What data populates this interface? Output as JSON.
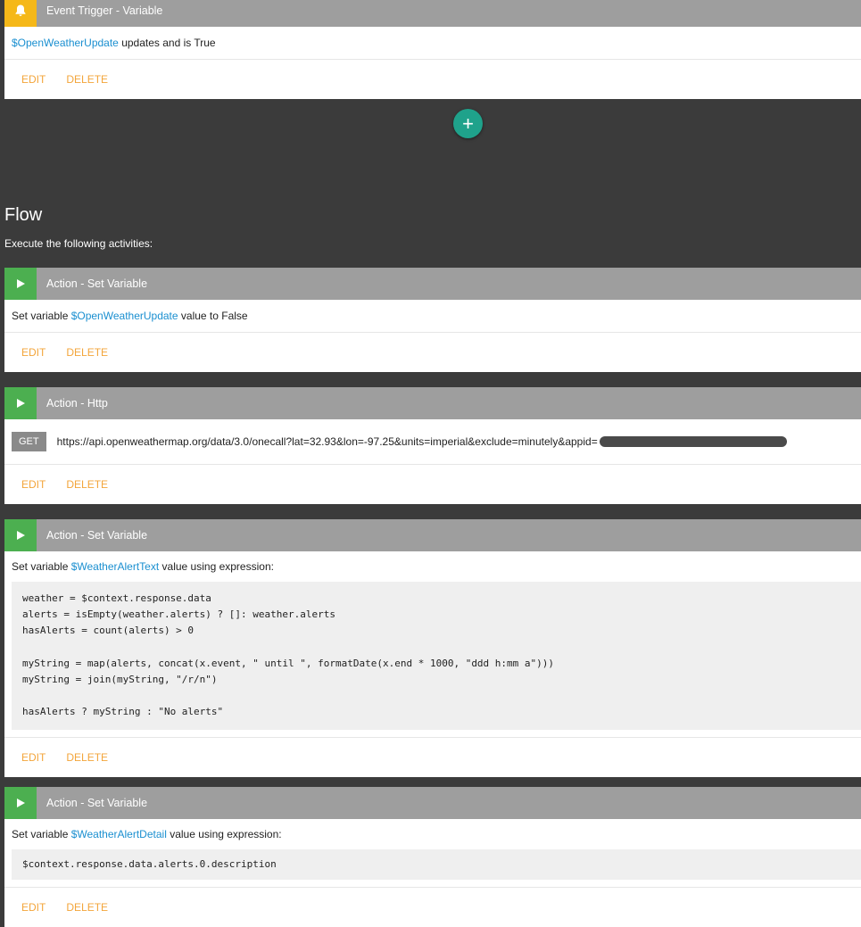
{
  "trigger": {
    "title": "Event Trigger - Variable",
    "var": "$OpenWeatherUpdate",
    "text": " updates and is True",
    "edit": "EDIT",
    "delete": "DELETE"
  },
  "add_button": "+",
  "flow": {
    "title": "Flow",
    "subtitle": "Execute the following activities:"
  },
  "actions": [
    {
      "title": "Action - Set Variable",
      "prefix": "Set variable ",
      "var": "$OpenWeatherUpdate",
      "suffix": " value to False",
      "edit": "EDIT",
      "delete": "DELETE"
    },
    {
      "title": "Action - Http",
      "method": "GET",
      "url": "https://api.openweathermap.org/data/3.0/onecall?lat=32.93&lon=-97.25&units=imperial&exclude=minutely&appid=",
      "edit": "EDIT",
      "delete": "DELETE"
    },
    {
      "title": "Action - Set Variable",
      "prefix": "Set variable ",
      "var": "$WeatherAlertText",
      "suffix": " value using expression:",
      "code": "weather = $context.response.data\nalerts = isEmpty(weather.alerts) ? []: weather.alerts\nhasAlerts = count(alerts) > 0\n\nmyString = map(alerts, concat(x.event, \" until \", formatDate(x.end * 1000, \"ddd h:mm a\")))\nmyString = join(myString, \"/r/n\")\n\nhasAlerts ? myString : \"No alerts\"",
      "edit": "EDIT",
      "delete": "DELETE"
    },
    {
      "title": "Action - Set Variable",
      "prefix": "Set variable ",
      "var": "$WeatherAlertDetail",
      "suffix": " value using expression:",
      "code": "$context.response.data.alerts.0.description",
      "edit": "EDIT",
      "delete": "DELETE"
    }
  ]
}
